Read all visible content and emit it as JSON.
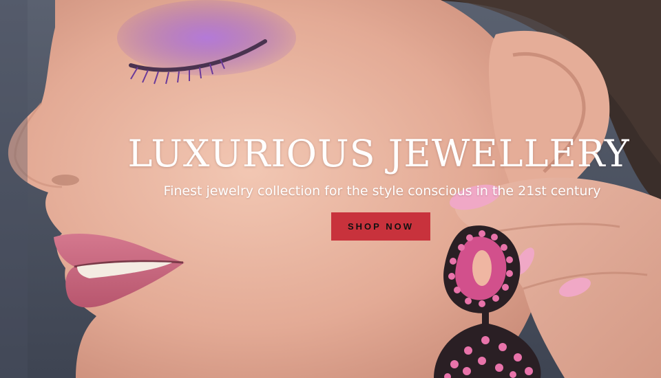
{
  "hero": {
    "headline": "LUXURIOUS JEWELLERY",
    "subheadline": "Finest jewelry collection for the style conscious in the 21st century",
    "cta_label": "SHOP NOW",
    "colors": {
      "cta_background": "#c8323c",
      "cta_text": "#111111",
      "headline_text": "#ffffff",
      "background_grey": "#4a5160",
      "skin": "#e8b4a0",
      "eyeshadow": "#9b5fc8",
      "lips": "#c96a80",
      "nails": "#f0a0c0",
      "earring_gems": "#d2508c",
      "hair": "#3a2e2a"
    },
    "image_icon": "model-with-earring-photo"
  }
}
